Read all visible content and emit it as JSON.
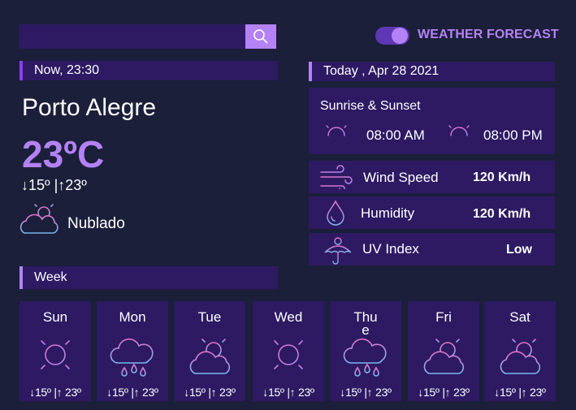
{
  "header": {
    "search_placeholder": "",
    "app_title": "WEATHER FORECAST"
  },
  "current": {
    "time_label": "Now, 23:30",
    "city": "Porto Alegre",
    "temperature": "23ºC",
    "min_max": "↓15º |↑23º",
    "condition": "Nublado"
  },
  "today": {
    "date_label": "Today , Apr 28 2021",
    "sun_title": "Sunrise & Sunset",
    "sunrise": "08:00 AM",
    "sunset": "08:00 PM",
    "wind_label": "Wind Speed",
    "wind_value": "120 Km/h",
    "humidity_label": "Humidity",
    "humidity_value": "120 Km/h",
    "uv_label": "UV Index",
    "uv_value": "Low"
  },
  "week": {
    "label": "Week",
    "days": [
      {
        "name": "Sun",
        "temp": "↓15º |↑ 23º",
        "icon": "sun-icon"
      },
      {
        "name": "Mon",
        "temp": "↓15º |↑ 23º",
        "icon": "rain-icon"
      },
      {
        "name": "Tue",
        "temp": "↓15º |↑ 23º",
        "icon": "partly-cloudy-icon"
      },
      {
        "name": "Wed",
        "temp": "↓15º |↑ 23º",
        "icon": "sun-icon"
      },
      {
        "name": "Thu\ne",
        "temp": "↓15º |↑ 23º",
        "icon": "rain-icon"
      },
      {
        "name": "Fri",
        "temp": "↓15º |↑ 23º",
        "icon": "partly-cloudy-icon"
      },
      {
        "name": "Sat",
        "temp": "↓15º |↑ 23º",
        "icon": "partly-cloudy-icon"
      }
    ]
  },
  "colors": {
    "background": "#1b1f3a",
    "panel": "#2d1a63",
    "accent": "#b482f5",
    "icon_pink": "#e46fc7",
    "icon_blue": "#79b8ec"
  }
}
